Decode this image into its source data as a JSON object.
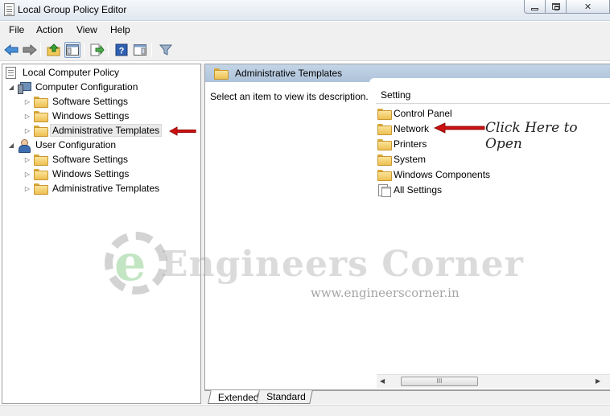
{
  "window": {
    "title": "Local Group Policy Editor"
  },
  "menu": {
    "file": "File",
    "action": "Action",
    "view": "View",
    "help": "Help"
  },
  "toolbar": {
    "buttons": [
      "back-icon",
      "forward-icon",
      "up-folder-icon",
      "show-hide-tree-icon",
      "export-list-icon",
      "help-icon",
      "show-hide-action-pane-icon",
      "filter-icon"
    ]
  },
  "tree": {
    "root": "Local Computer Policy",
    "computer_config": "Computer Configuration",
    "cc_items": [
      "Software Settings",
      "Windows Settings",
      "Administrative Templates"
    ],
    "user_config": "User Configuration",
    "uc_items": [
      "Software Settings",
      "Windows Settings",
      "Administrative Templates"
    ],
    "selected": "Administrative Templates"
  },
  "right_pane": {
    "header": "Administrative Templates",
    "description": "Select an item to view its description.",
    "column_header": "Setting",
    "items": [
      "Control Panel",
      "Network",
      "Printers",
      "System",
      "Windows Components",
      "All Settings"
    ]
  },
  "annotation": {
    "text": "Click Here to Open",
    "color": "#cc1111"
  },
  "scrollbar": {
    "thumb_grip": "III"
  },
  "tabs": {
    "extended": "Extended",
    "standard": "Standard",
    "active": "Extended"
  },
  "watermark": {
    "logo_letter": "e",
    "text": "Engineers Corner",
    "url": "www.engineerscorner.in"
  },
  "colors": {
    "header_blue": "#aec3da",
    "arrow_red": "#cc1111"
  }
}
